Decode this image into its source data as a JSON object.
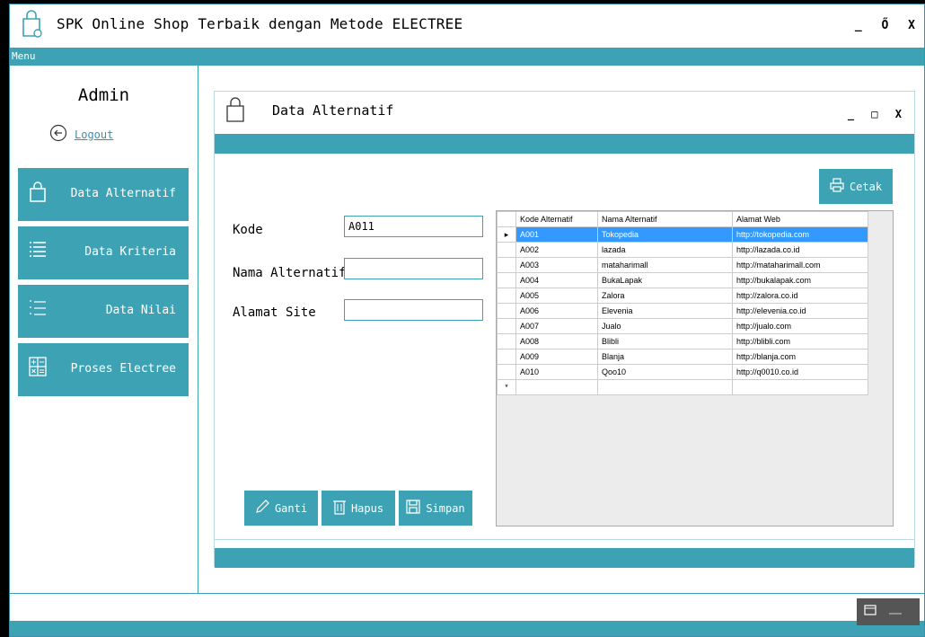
{
  "app": {
    "title": "SPK Online Shop Terbaik dengan Metode ELECTREE",
    "min": "_",
    "max": "Ő",
    "close": "X"
  },
  "menu": {
    "label": "Menu"
  },
  "sidebar": {
    "user": "Admin",
    "logout": "Logout",
    "items": [
      {
        "label": "Data Alternatif",
        "icon": "shopping-bag-icon"
      },
      {
        "label": "Data Kriteria",
        "icon": "list-icon"
      },
      {
        "label": "Data Nilai",
        "icon": "numbered-list-icon"
      },
      {
        "label": "Proses Electree",
        "icon": "calculator-icon"
      }
    ]
  },
  "inner": {
    "title": "Data Alternatif",
    "min": "_",
    "max": "□",
    "close": "X"
  },
  "form": {
    "kode_label": "Kode",
    "kode_value": "A011",
    "nama_label": "Nama Alternatif",
    "nama_value": "",
    "alamat_label": "Alamat Site",
    "alamat_value": ""
  },
  "buttons": {
    "ganti": "Ganti",
    "hapus": "Hapus",
    "simpan": "Simpan",
    "cetak": "Cetak"
  },
  "table": {
    "headers": [
      "Kode Alternatif",
      "Nama Alternatif",
      "Alamat Web"
    ],
    "rows": [
      [
        "A001",
        "Tokopedia",
        "http://tokopedia.com"
      ],
      [
        "A002",
        "lazada",
        "http://lazada.co.id"
      ],
      [
        "A003",
        "mataharimall",
        "http://mataharimall.com"
      ],
      [
        "A004",
        "BukaLapak",
        "http://bukalapak.com"
      ],
      [
        "A005",
        "Zalora",
        "http://zalora.co.id"
      ],
      [
        "A006",
        "Elevenia",
        "http://elevenia.co.id"
      ],
      [
        "A007",
        "Jualo",
        "http://jualo.com"
      ],
      [
        "A008",
        "Blibli",
        "http://blibli.com"
      ],
      [
        "A009",
        "Blanja",
        "http://blanja.com"
      ],
      [
        "A010",
        "Qoo10",
        "http://q0010.co.id"
      ]
    ],
    "selected_marker": "▸",
    "new_row_marker": "*"
  },
  "colors": {
    "accent": "#3ea2b5",
    "selection": "#3399ff"
  }
}
